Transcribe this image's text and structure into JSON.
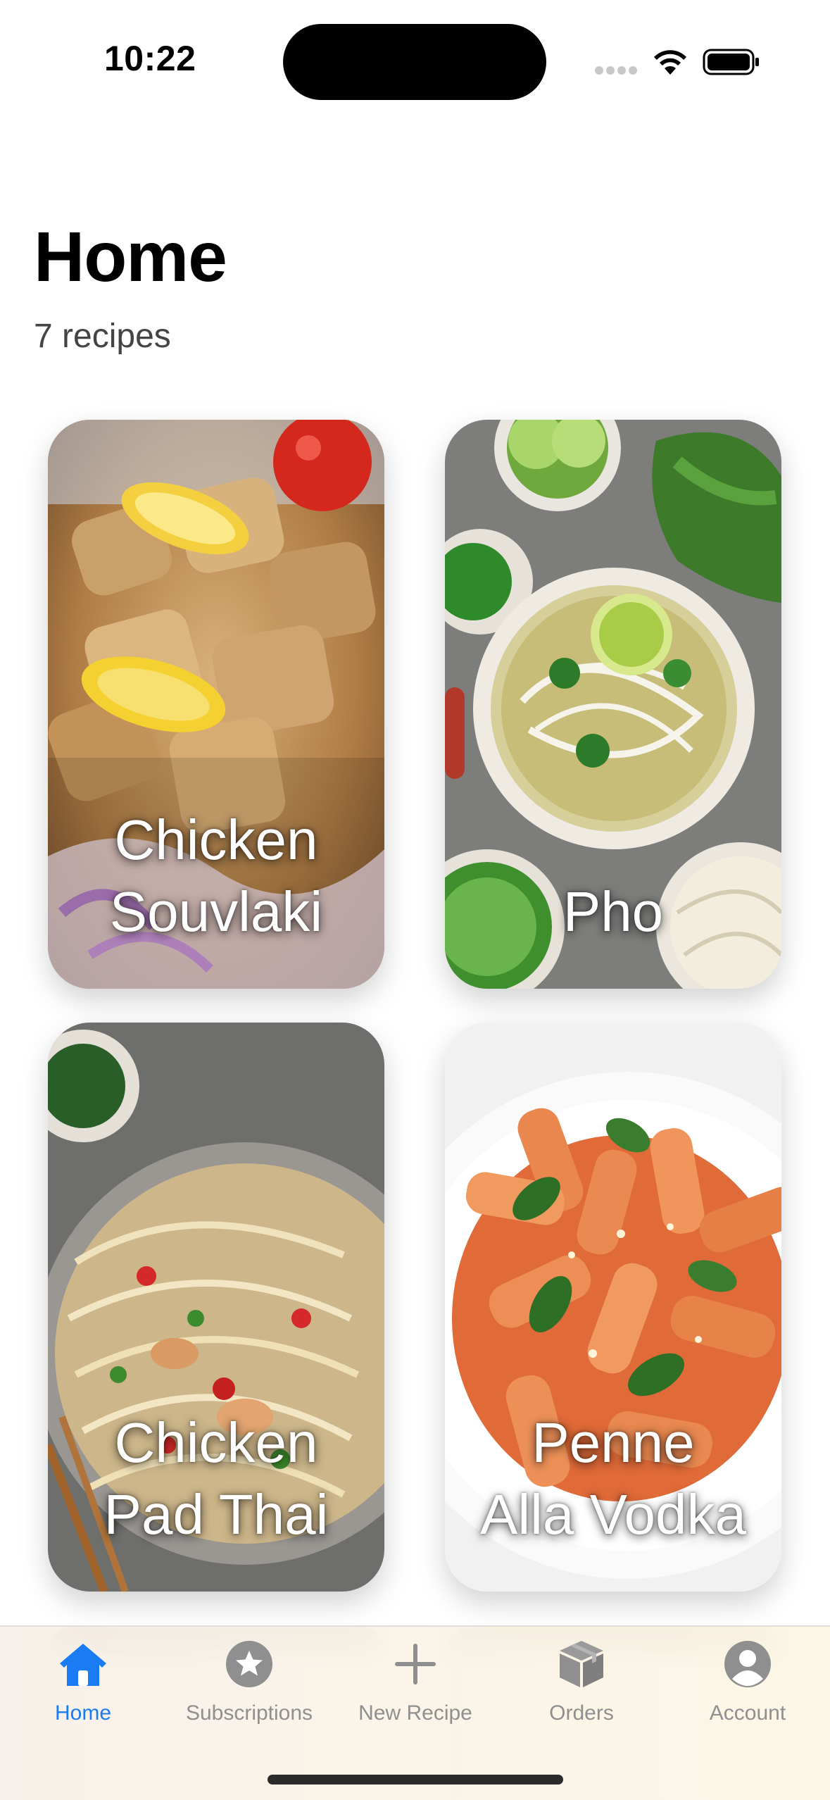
{
  "status_bar": {
    "time": "10:22",
    "wifi_icon": "wifi-icon",
    "battery_icon": "battery-icon"
  },
  "header": {
    "title": "Home",
    "subtitle": "7 recipes"
  },
  "recipes": [
    {
      "title_line1": "Chicken",
      "title_line2": "Souvlaki"
    },
    {
      "title_line1": "",
      "title_line2": "Pho"
    },
    {
      "title_line1": "Chicken",
      "title_line2": "Pad Thai"
    },
    {
      "title_line1": "Penne",
      "title_line2": "Alla Vodka"
    }
  ],
  "tab_bar": {
    "items": [
      {
        "label": "Home",
        "icon": "house-icon",
        "active": true
      },
      {
        "label": "Subscriptions",
        "icon": "star-circle-icon",
        "active": false
      },
      {
        "label": "New Recipe",
        "icon": "plus-icon",
        "active": false
      },
      {
        "label": "Orders",
        "icon": "box-icon",
        "active": false
      },
      {
        "label": "Account",
        "icon": "person-circle-icon",
        "active": false
      }
    ],
    "active_color": "#1a7cf2",
    "inactive_color": "#8f8f8f"
  }
}
